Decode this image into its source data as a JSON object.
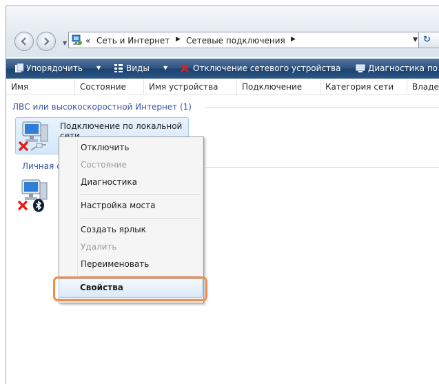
{
  "address_bar": {
    "prefix": "«",
    "crumbs": [
      "Сеть и Интернет",
      "Сетевые подключения"
    ]
  },
  "toolbar": {
    "organize": "Упорядочить",
    "views": "Виды",
    "disable_device": "Отключение сетевого устройства",
    "diagnose": "Диагностика по"
  },
  "columns": [
    "Имя",
    "Состояние",
    "Имя устройства",
    "Подключение",
    "Категория сети",
    "Владе"
  ],
  "groups": {
    "lan": "ЛВС или высокоскоростной Интернет (1)",
    "pan": "Личная с"
  },
  "items": {
    "lan_label": "Подключение по локальной сети"
  },
  "context_menu": {
    "items": [
      {
        "label": "Отключить",
        "enabled": true
      },
      {
        "label": "Состояние",
        "enabled": false
      },
      {
        "label": "Диагностика",
        "enabled": true
      },
      {
        "label": "Настройка моста",
        "enabled": true
      },
      {
        "label": "Создать ярлык",
        "enabled": true
      },
      {
        "label": "Удалить",
        "enabled": false
      },
      {
        "label": "Переименовать",
        "enabled": true
      },
      {
        "label": "Свойства",
        "enabled": true,
        "default": true,
        "highlighted": true
      }
    ]
  },
  "colors": {
    "toolbar": "#2d5381",
    "group_text": "#3a55a2",
    "highlight": "#f28a47",
    "error_x": "#e0201a"
  },
  "icons": [
    "back-icon",
    "forward-icon",
    "network-folder-icon",
    "refresh-icon",
    "organize-icon",
    "views-icon",
    "disable-icon",
    "diagnose-icon",
    "computer-icon",
    "network-cable-icon",
    "bluetooth-icon",
    "error-x-icon"
  ]
}
